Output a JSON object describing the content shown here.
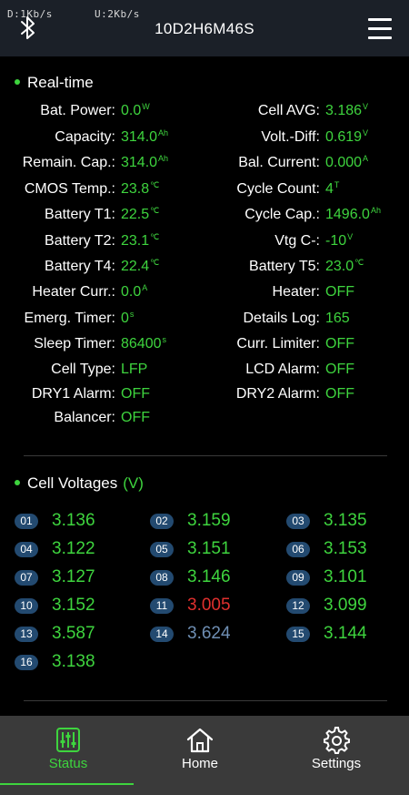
{
  "status_bar": {
    "download": "D:1Kb/s",
    "upload": "U:2Kb/s"
  },
  "header": {
    "title": "10D2H6M46S"
  },
  "realtime": {
    "title": "Real-time",
    "rows": [
      {
        "l_label": "Bat. Power:",
        "l_value": "0.0",
        "l_unit": "W",
        "r_label": "Cell AVG:",
        "r_value": "3.186",
        "r_unit": "V"
      },
      {
        "l_label": "Capacity:",
        "l_value": "314.0",
        "l_unit": "Ah",
        "r_label": "Volt.-Diff:",
        "r_value": "0.619",
        "r_unit": "V"
      },
      {
        "l_label": "Remain. Cap.:",
        "l_value": "314.0",
        "l_unit": "Ah",
        "r_label": "Bal. Current:",
        "r_value": "0.000",
        "r_unit": "A"
      },
      {
        "l_label": "CMOS Temp.:",
        "l_value": "23.8",
        "l_unit": "℃",
        "r_label": "Cycle Count:",
        "r_value": "4",
        "r_unit": "T"
      },
      {
        "l_label": "Battery T1:",
        "l_value": "22.5",
        "l_unit": "℃",
        "r_label": "Cycle Cap.:",
        "r_value": "1496.0",
        "r_unit": "Ah"
      },
      {
        "l_label": "Battery T2:",
        "l_value": "23.1",
        "l_unit": "℃",
        "r_label": "Vtg C-:",
        "r_value": "-10",
        "r_unit": "V"
      },
      {
        "l_label": "Battery T4:",
        "l_value": "22.4",
        "l_unit": "℃",
        "r_label": "Battery T5:",
        "r_value": "23.0",
        "r_unit": "℃"
      },
      {
        "l_label": "Heater Curr.:",
        "l_value": "0.0",
        "l_unit": "A",
        "r_label": "Heater:",
        "r_value": "OFF",
        "r_unit": ""
      },
      {
        "l_label": "Emerg. Timer:",
        "l_value": "0",
        "l_unit": "s",
        "r_label": "Details Log:",
        "r_value": "165",
        "r_unit": ""
      },
      {
        "l_label": "Sleep Timer:",
        "l_value": "86400",
        "l_unit": "s",
        "r_label": "Curr. Limiter:",
        "r_value": "OFF",
        "r_unit": ""
      },
      {
        "l_label": "Cell Type:",
        "l_value": "LFP",
        "l_unit": "",
        "r_label": "LCD Alarm:",
        "r_value": "OFF",
        "r_unit": ""
      },
      {
        "l_label": "DRY1 Alarm:",
        "l_value": "OFF",
        "l_unit": "",
        "r_label": "DRY2 Alarm:",
        "r_value": "OFF",
        "r_unit": ""
      },
      {
        "l_label": "Balancer:",
        "l_value": "OFF",
        "l_unit": "",
        "r_label": "",
        "r_value": "",
        "r_unit": ""
      }
    ]
  },
  "cell_voltages": {
    "title": "Cell Voltages",
    "unit": "(V)",
    "colors": {
      "normal": "#3ed43e",
      "min": "#e0302e",
      "max": "#6f8fb4",
      "badge": "#234a70"
    },
    "cells": [
      {
        "no": "01",
        "v": "3.136",
        "state": "normal"
      },
      {
        "no": "02",
        "v": "3.159",
        "state": "normal"
      },
      {
        "no": "03",
        "v": "3.135",
        "state": "normal"
      },
      {
        "no": "04",
        "v": "3.122",
        "state": "normal"
      },
      {
        "no": "05",
        "v": "3.151",
        "state": "normal"
      },
      {
        "no": "06",
        "v": "3.153",
        "state": "normal"
      },
      {
        "no": "07",
        "v": "3.127",
        "state": "normal"
      },
      {
        "no": "08",
        "v": "3.146",
        "state": "normal"
      },
      {
        "no": "09",
        "v": "3.101",
        "state": "normal"
      },
      {
        "no": "10",
        "v": "3.152",
        "state": "normal"
      },
      {
        "no": "11",
        "v": "3.005",
        "state": "min"
      },
      {
        "no": "12",
        "v": "3.099",
        "state": "normal"
      },
      {
        "no": "13",
        "v": "3.587",
        "state": "normal"
      },
      {
        "no": "14",
        "v": "3.624",
        "state": "max"
      },
      {
        "no": "15",
        "v": "3.144",
        "state": "normal"
      },
      {
        "no": "16",
        "v": "3.138",
        "state": "normal"
      }
    ]
  },
  "tabs": [
    {
      "label": "Status",
      "icon": "sliders-icon",
      "active": true
    },
    {
      "label": "Home",
      "icon": "home-icon",
      "active": false
    },
    {
      "label": "Settings",
      "icon": "gear-icon",
      "active": false
    }
  ],
  "accent_color": "#3ed43e"
}
